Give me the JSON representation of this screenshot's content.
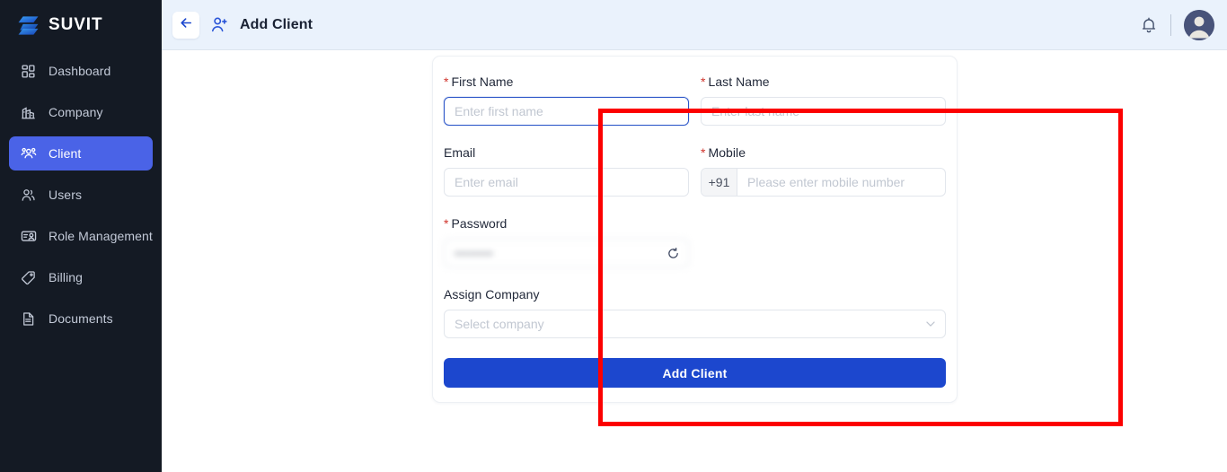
{
  "brand": {
    "name": "SUVIT",
    "logo_icon": "suvit-s-logo"
  },
  "sidebar": {
    "items": [
      {
        "label": "Dashboard",
        "icon": "grid-dashboard-icon",
        "active": false
      },
      {
        "label": "Company",
        "icon": "building-icon",
        "active": false
      },
      {
        "label": "Client",
        "icon": "users-group-icon",
        "active": true
      },
      {
        "label": "Users",
        "icon": "user-pair-icon",
        "active": false
      },
      {
        "label": "Role Management",
        "icon": "id-card-user-icon",
        "active": false
      },
      {
        "label": "Billing",
        "icon": "tag-icon",
        "active": false
      },
      {
        "label": "Documents",
        "icon": "document-file-icon",
        "active": false
      }
    ]
  },
  "topbar": {
    "back_icon": "arrow-left-icon",
    "page_icon": "user-plus-icon",
    "title": "Add Client",
    "bell_icon": "bell-icon",
    "avatar_icon": "user-avatar"
  },
  "form": {
    "fields": {
      "first_name": {
        "label": "First Name",
        "required": true,
        "placeholder": "Enter first name",
        "value": "",
        "focused": true
      },
      "last_name": {
        "label": "Last Name",
        "required": true,
        "placeholder": "Enter last name",
        "value": "",
        "focused": false
      },
      "email": {
        "label": "Email",
        "required": false,
        "placeholder": "Enter email",
        "value": "",
        "focused": false
      },
      "mobile": {
        "label": "Mobile",
        "required": true,
        "country_code": "+91",
        "placeholder": "Please enter mobile number",
        "value": "",
        "focused": false
      },
      "password": {
        "label": "Password",
        "required": true,
        "value": "••••••••",
        "masked": true,
        "action_icon": "refresh-generate-icon"
      },
      "assign_company": {
        "label": "Assign Company",
        "required": false,
        "placeholder": "Select company",
        "value": "",
        "caret_icon": "chevron-down-icon"
      }
    },
    "submit_label": "Add Client"
  },
  "annotation": {
    "type": "highlight-rectangle",
    "color": "#fc0000"
  },
  "colors": {
    "sidebar_bg": "#141a24",
    "sidebar_active": "#4a63e7",
    "topbar_bg": "#eaf2fc",
    "primary_button": "#1c47ce",
    "required_star": "#d0342c",
    "annotation": "#fc0000"
  }
}
